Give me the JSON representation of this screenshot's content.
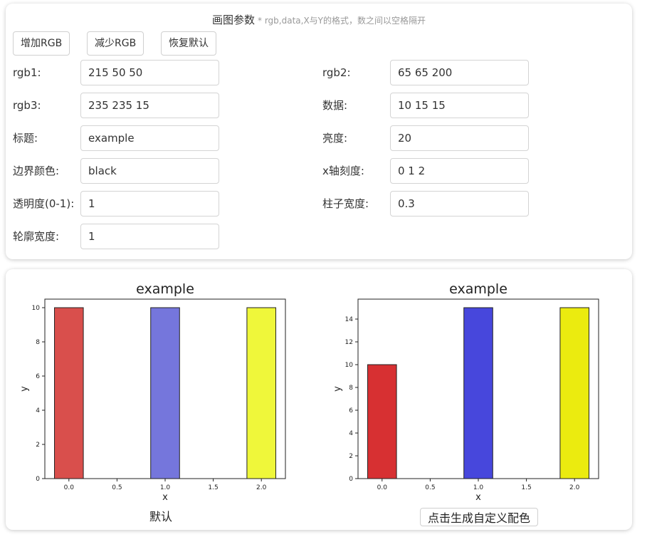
{
  "header": {
    "title": "画图参数",
    "hint": "* rgb,data,X与Y的格式，数之间以空格隔开"
  },
  "toolbar": {
    "add_rgb": "增加RGB",
    "remove_rgb": "减少RGB",
    "reset": "恢复默认"
  },
  "fields": {
    "rgb1": {
      "label": "rgb1:",
      "value": "215 50 50"
    },
    "rgb2": {
      "label": "rgb2:",
      "value": "65 65 200"
    },
    "rgb3": {
      "label": "rgb3:",
      "value": "235 235 15"
    },
    "data": {
      "label": "数据:",
      "value": "10 15 15"
    },
    "title": {
      "label": "标题:",
      "value": "example"
    },
    "brightness": {
      "label": "亮度:",
      "value": "20"
    },
    "edge_color": {
      "label": "边界颜色:",
      "value": "black"
    },
    "xticks": {
      "label": "x轴刻度:",
      "value": "0 1 2"
    },
    "alpha": {
      "label": "透明度(0-1):",
      "value": "1"
    },
    "bar_width": {
      "label": "柱子宽度:",
      "value": "0.3"
    },
    "line_width": {
      "label": "轮廓宽度:",
      "value": "1"
    }
  },
  "captions": {
    "default": "默认",
    "generate_button": "点击生成自定义配色"
  },
  "chart_data": [
    {
      "type": "bar",
      "title": "example",
      "xlabel": "x",
      "ylabel": "y",
      "x": [
        0,
        1,
        2
      ],
      "values": [
        10,
        10,
        10
      ],
      "colors": [
        "#d94f4c",
        "#7576dc",
        "#eff73a"
      ],
      "edgecolor": "#222222",
      "xlim": [
        -0.25,
        2.25
      ],
      "ylim": [
        0,
        10.5
      ],
      "xticks": [
        "0.0",
        "0.5",
        "1.0",
        "1.5",
        "2.0"
      ],
      "yticks": [
        "0",
        "2",
        "4",
        "6",
        "8",
        "10"
      ],
      "grid": false
    },
    {
      "type": "bar",
      "title": "example",
      "xlabel": "x",
      "ylabel": "y",
      "x": [
        0,
        1,
        2
      ],
      "values": [
        10,
        15,
        15
      ],
      "colors": [
        "#d73032",
        "#4747dc",
        "#ebeb0f"
      ],
      "edgecolor": "#222222",
      "xlim": [
        -0.25,
        2.25
      ],
      "ylim": [
        0,
        15.75
      ],
      "xticks": [
        "0.0",
        "0.5",
        "1.0",
        "1.5",
        "2.0"
      ],
      "yticks": [
        "0",
        "2",
        "4",
        "6",
        "8",
        "10",
        "12",
        "14"
      ],
      "grid": false
    }
  ]
}
